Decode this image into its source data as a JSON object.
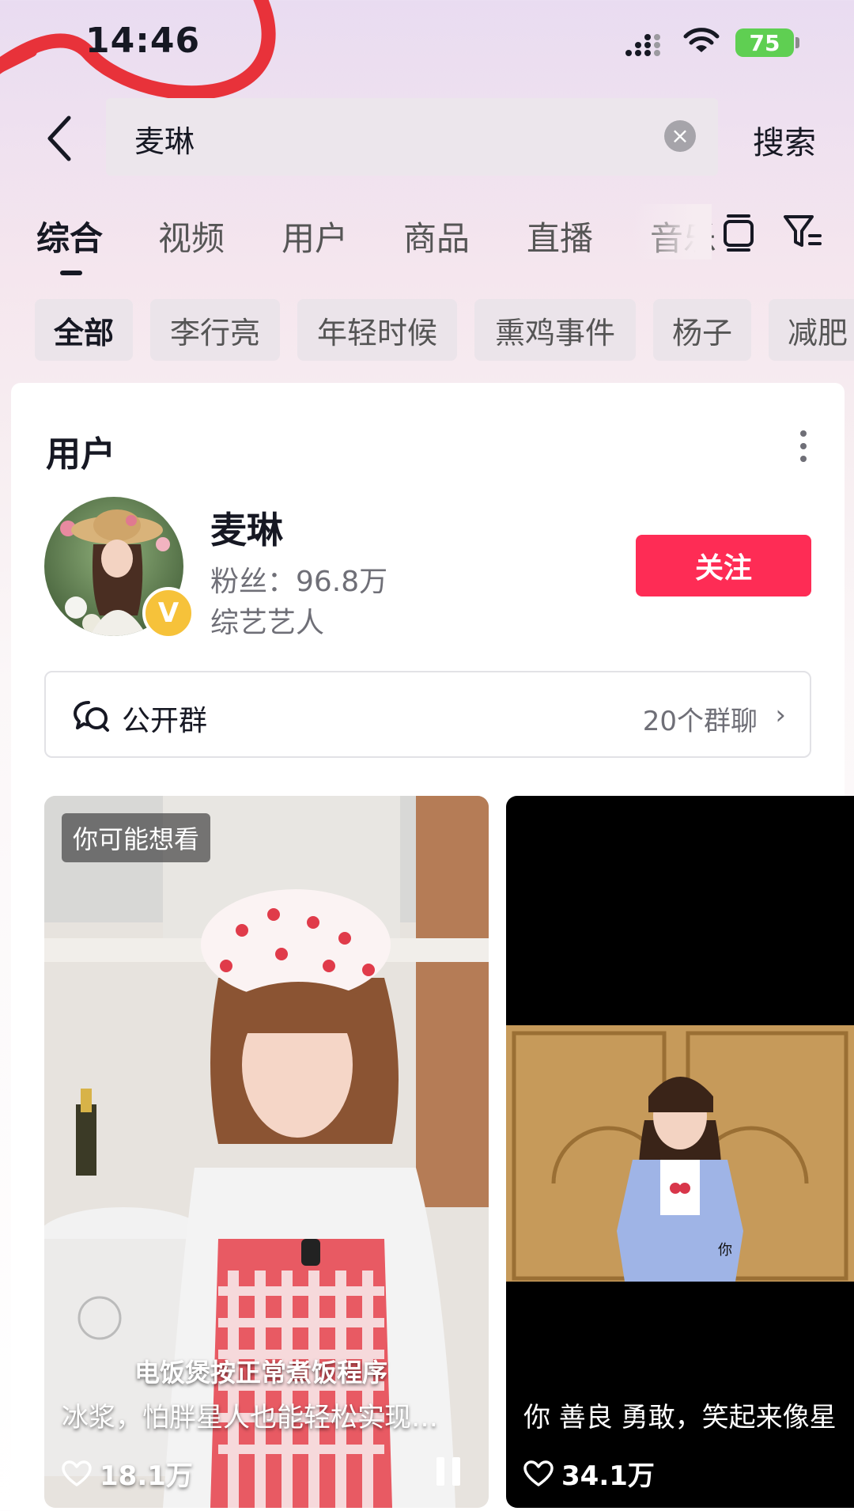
{
  "status_bar": {
    "time": "14:46",
    "battery": "75"
  },
  "search": {
    "query": "麦琳",
    "submit_label": "搜索"
  },
  "tabs": [
    {
      "label": "综合"
    },
    {
      "label": "视频"
    },
    {
      "label": "用户"
    },
    {
      "label": "商品"
    },
    {
      "label": "直播"
    },
    {
      "label": "音乐"
    }
  ],
  "chips": [
    {
      "label": "全部"
    },
    {
      "label": "李行亮"
    },
    {
      "label": "年轻时候"
    },
    {
      "label": "熏鸡事件"
    },
    {
      "label": "杨子"
    },
    {
      "label": "减肥"
    }
  ],
  "user_section": {
    "title": "用户",
    "name": "麦琳",
    "fans": "粉丝：96.8万",
    "category": "综艺艺人",
    "verified_label": "V",
    "follow_label": "关注",
    "group_label": "公开群",
    "group_count": "20个群聊",
    "group_chevron": "›"
  },
  "videos": [
    {
      "badge": "你可能想看",
      "caption_line1": "电饭煲按正常煮饭程序",
      "caption_line2": "冰浆，怕胖星人也能轻松实现…",
      "likes": "18.1万",
      "state": "playing"
    },
    {
      "caption": "你 善良 勇敢，笑起来像星",
      "subtitle_char": "你",
      "likes": "34.1万"
    }
  ],
  "colors": {
    "accent": "#fe2c55",
    "verified": "#f6c23a",
    "battery": "#5fcf52"
  }
}
